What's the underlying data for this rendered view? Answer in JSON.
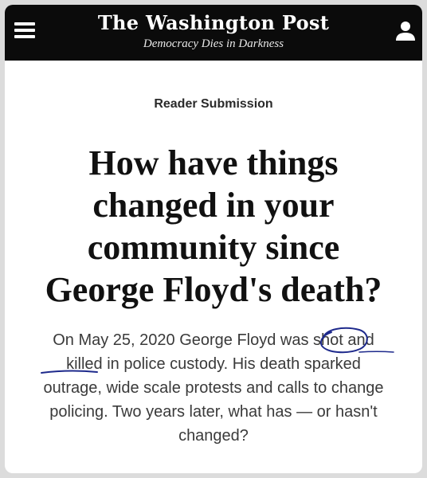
{
  "masthead": {
    "logo": "The Washington Post",
    "tagline": "Democracy Dies in Darkness",
    "menu_icon": "hamburger-menu-icon",
    "account_icon": "user-account-icon",
    "background": "#0b0b0b"
  },
  "article": {
    "label": "Reader Submission",
    "headline_lines": [
      "How have things",
      "changed in your",
      "community since",
      "George Floyd's death?"
    ],
    "dek_lines": [
      "On May 25, 2020 George Floyd was shot and",
      "killed in police custody. His death sparked",
      "outrage, wide scale protests and calls to change",
      "policing. Two years later, what has — or hasn't",
      "changed?"
    ]
  },
  "annotation": {
    "ink_color": "#1e2a8c",
    "marks": [
      "circle around shot",
      "underline under killed"
    ]
  }
}
